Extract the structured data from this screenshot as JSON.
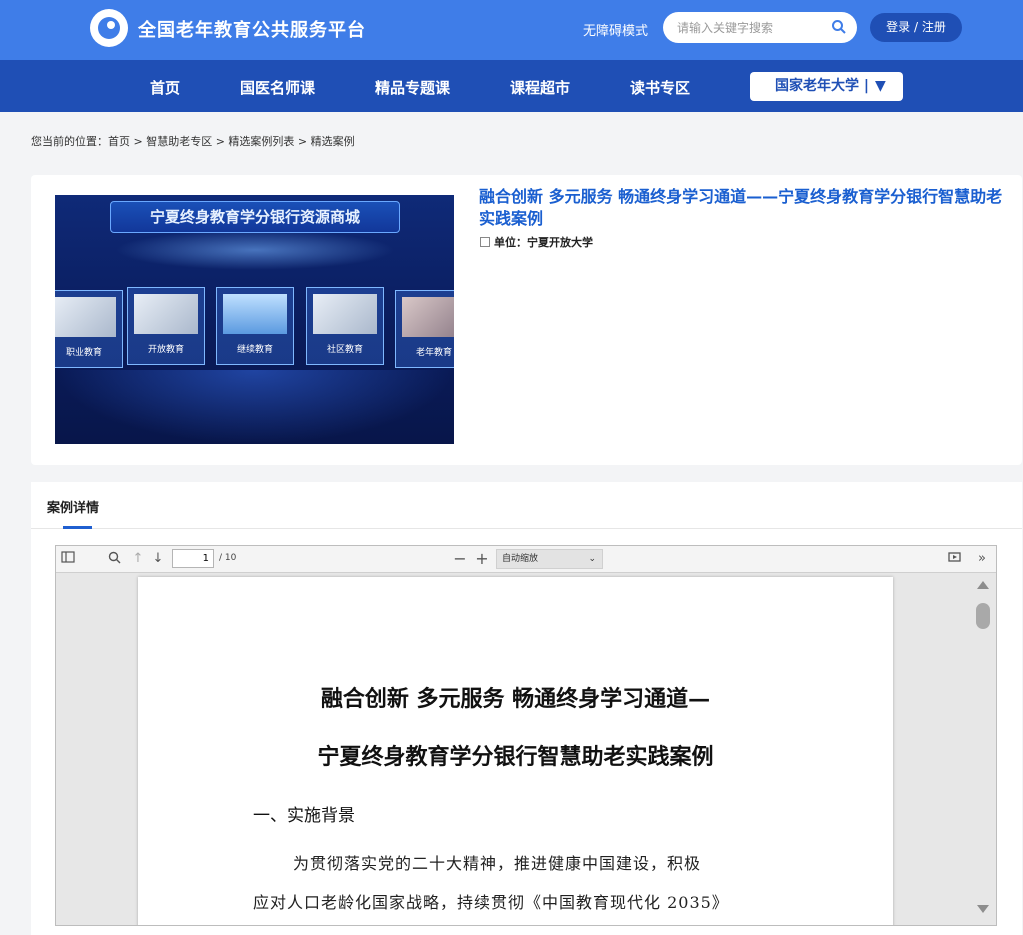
{
  "header": {
    "site_title": "全国老年教育公共服务平台",
    "accessibility_label": "无障碍模式",
    "search_placeholder": "请输入关键字搜索",
    "login_label": "登录 / 注册"
  },
  "nav": {
    "items": [
      "首页",
      "国医名师课",
      "精品专题课",
      "课程超市",
      "读书专区"
    ],
    "dropdown_label": "国家老年大学 |"
  },
  "breadcrumb": "您当前的位置：首页 > 智慧助老专区 > 精选案例列表 > 精选案例",
  "case": {
    "title": "融合创新 多元服务 畅通终身学习通道——宁夏终身教育学分银行智慧助老实践案例",
    "unit_label": "单位：宁夏开放大学",
    "cover": {
      "banner": "宁夏终身教育学分银行资源商城",
      "panels": [
        "职业教育",
        "开放教育",
        "继续教育",
        "社区教育",
        "老年教育"
      ]
    }
  },
  "detail": {
    "tab_label": "案例详情"
  },
  "viewer": {
    "current_page": "1",
    "total_pages": "/ 10",
    "zoom_label": "自动缩放",
    "doc": {
      "title_line1": "融合创新  多元服务  畅通终身学习通道—",
      "title_line2": "宁夏终身教育学分银行智慧助老实践案例",
      "section_heading": "一、实施背景",
      "para_line1": "为贯彻落实党的二十大精神，推进健康中国建设，积极",
      "para_line2": "应对人口老龄化国家战略，持续贯彻《中国教育现代化 2035》"
    }
  },
  "colors": {
    "brand_blue": "#3f7de8",
    "nav_blue": "#1f4fb5",
    "title_blue": "#1a5fd0"
  }
}
